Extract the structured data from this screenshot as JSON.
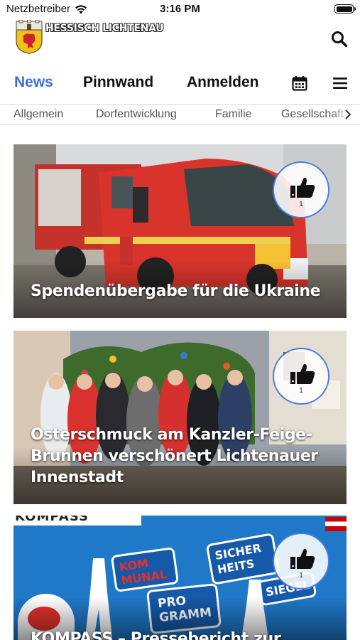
{
  "status": {
    "carrier": "Netzbetreiber",
    "time": "3:16 PM"
  },
  "header": {
    "app_title": "HESSISCH LICHTENAU"
  },
  "nav": {
    "tabs": [
      "News",
      "Pinnwand",
      "Anmelden"
    ],
    "active": "News"
  },
  "categories": [
    "Allgemein",
    "Dorfentwicklung",
    "Familie",
    "Gesellschaft"
  ],
  "posts": [
    {
      "title": "Spendenübergabe für die Ukraine",
      "likes": "1"
    },
    {
      "title": "Osterschmuck am Kanzler-Feige-Brunnen verschönert Lichtenauer Innenstadt",
      "likes": "1"
    },
    {
      "title": "KOMPASS – Pressebericht zur",
      "likes": "1",
      "image_texts": [
        "KOMPASS",
        "KOM MUNAL",
        "PRO GRAMM",
        "SICHER HEITS",
        "SIEGEL"
      ]
    }
  ],
  "colors": {
    "accent": "#3a6fd8",
    "like_border": "#4a7be0"
  }
}
